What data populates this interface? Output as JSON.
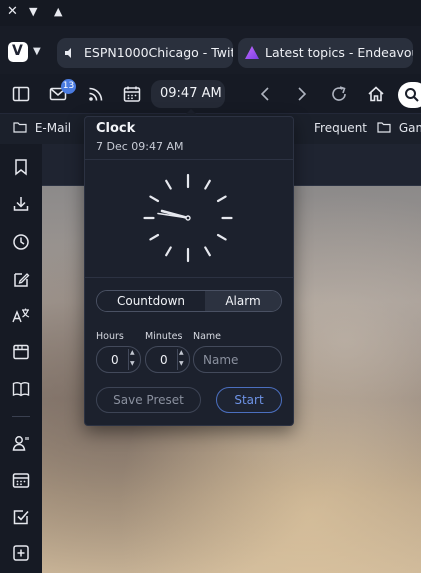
{
  "title_bar": {
    "icons": [
      "close-icon",
      "minimize-icon",
      "maximize-icon"
    ]
  },
  "tab_bar": {
    "tabs": [
      {
        "label": "ESPN1000Chicago - Twit",
        "icon": "speaker-icon"
      },
      {
        "label": "Latest topics - Endeavour",
        "icon": "endeavour-icon"
      }
    ]
  },
  "toolbar": {
    "mail_badge": "13",
    "clock_time": "09:47 AM",
    "icons": [
      "panel-toggle-icon",
      "mail-icon",
      "rss-icon",
      "calendar-icon",
      "back-icon",
      "forward-icon",
      "reload-icon",
      "home-icon",
      "search-icon"
    ]
  },
  "bookmarks": {
    "items": [
      {
        "label": "E-Mail"
      },
      {
        "label": "Frequent"
      },
      {
        "label": "Gam"
      }
    ]
  },
  "clock_popup": {
    "title": "Clock",
    "date": "7 Dec 09:47 AM",
    "modes": {
      "countdown": "Countdown",
      "alarm": "Alarm"
    },
    "fields": {
      "hours_label": "Hours",
      "minutes_label": "Minutes",
      "name_label": "Name",
      "hours_value": "0",
      "minutes_value": "0",
      "name_placeholder": "Name"
    },
    "buttons": {
      "save_preset": "Save Preset",
      "start": "Start"
    }
  },
  "colors": {
    "accent": "#4a7be0",
    "start_text": "#6e93e6",
    "panel_bg": "#1c212d"
  }
}
